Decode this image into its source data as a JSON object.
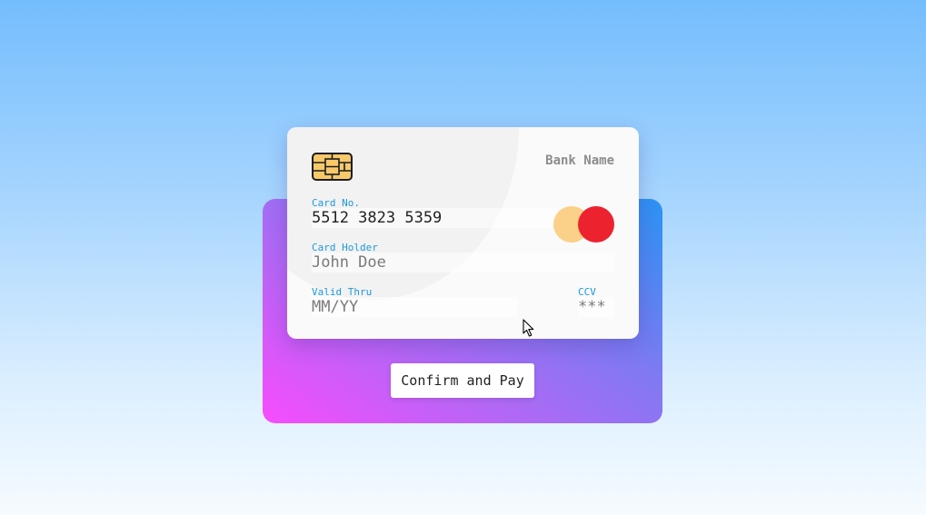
{
  "card": {
    "bank_name": "Bank Name",
    "number_label": "Card No.",
    "number_value": "5512 3823 5359",
    "holder_label": "Card Holder",
    "holder_placeholder": "John Doe",
    "valid_label": "Valid Thru",
    "valid_placeholder": "MM/YY",
    "ccv_label": "CCV",
    "ccv_placeholder": "***"
  },
  "actions": {
    "pay_label": "Confirm and Pay"
  },
  "icons": {
    "chip": "card-chip-icon",
    "brand": "mastercard-logo-icon",
    "cursor": "mouse-pointer-icon"
  },
  "colors": {
    "label_blue": "#1e9ad6",
    "mc_orange": "#fbd088",
    "mc_red": "#ec232f",
    "panel_gradient_start": "#f74cfd",
    "panel_gradient_end": "#2a93f4"
  }
}
